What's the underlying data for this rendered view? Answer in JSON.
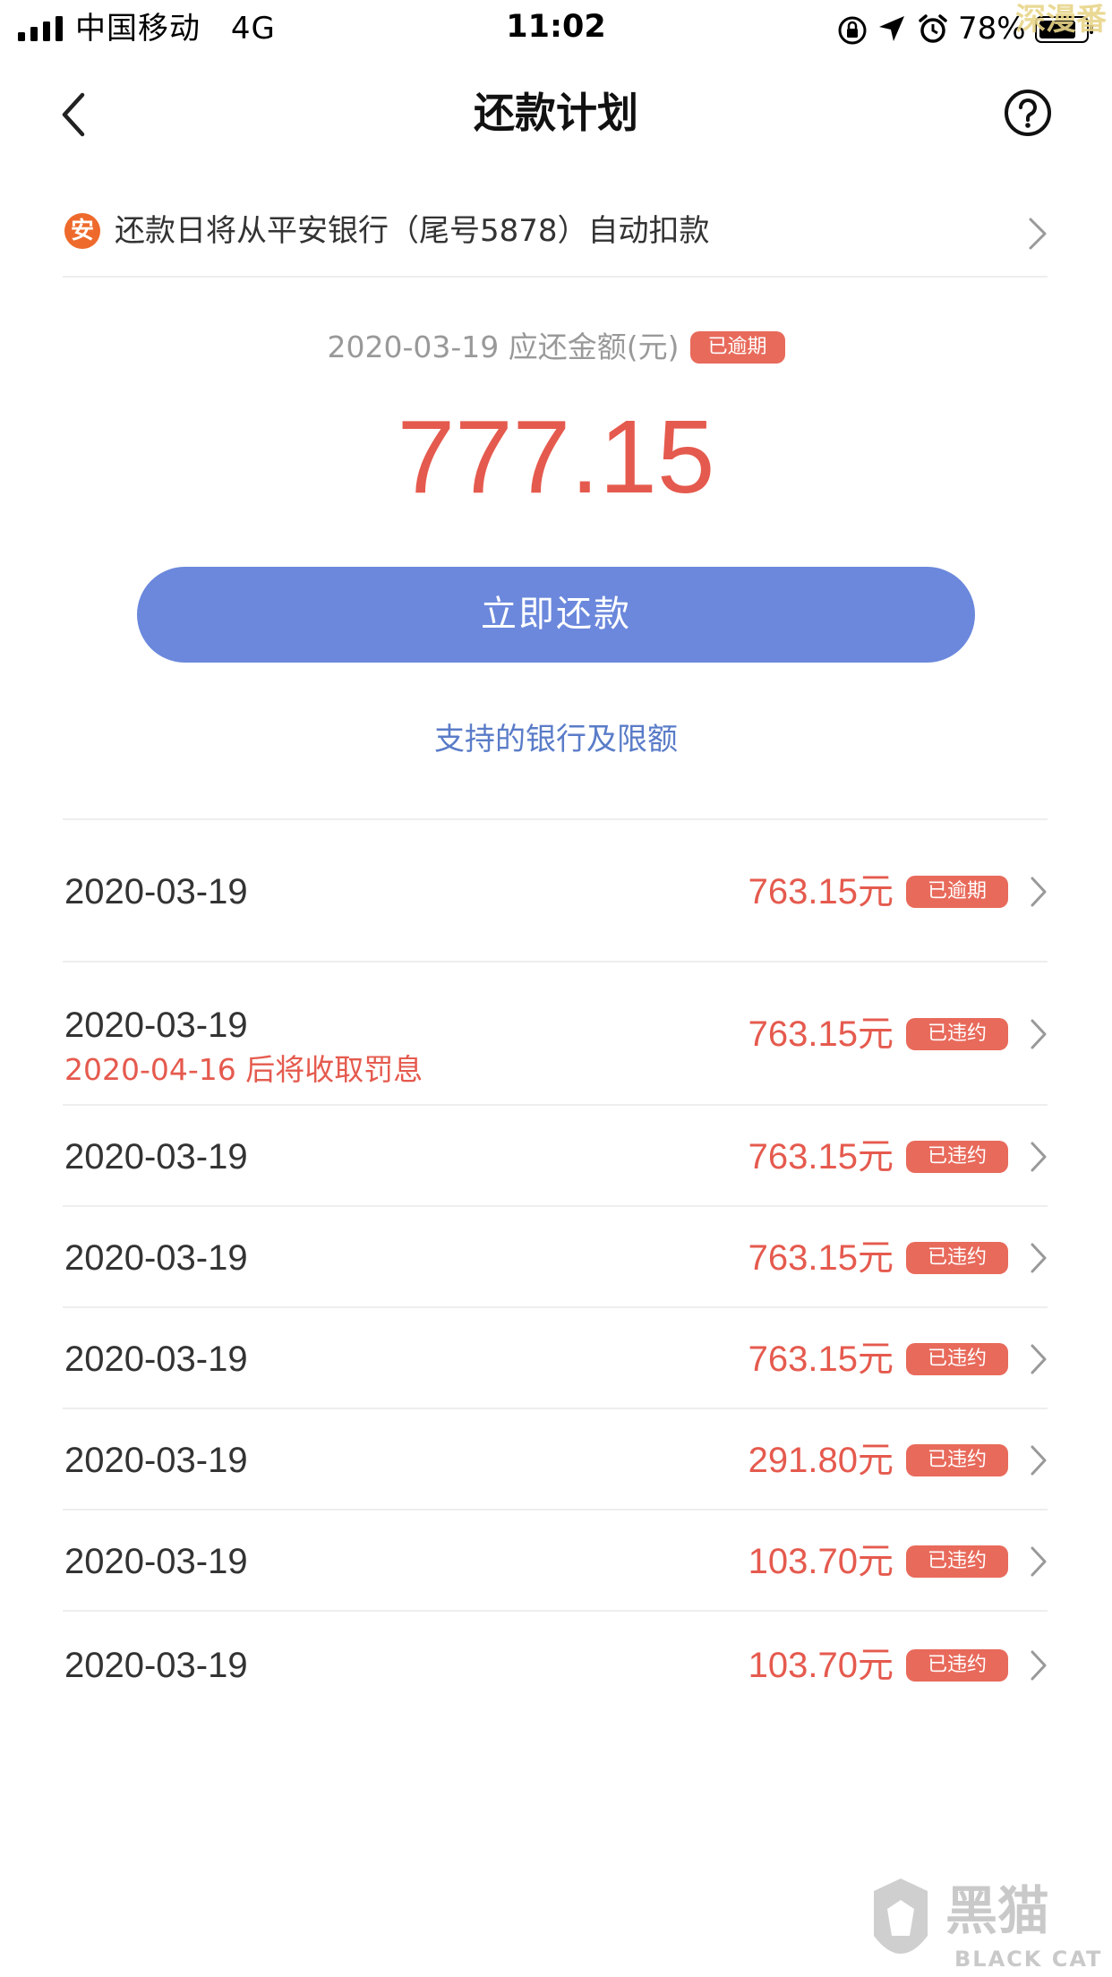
{
  "status_bar": {
    "carrier": "中国移动",
    "network": "4G",
    "time": "11:02",
    "battery_percent": "78%",
    "watermark": "深漫番"
  },
  "nav": {
    "title": "还款计划",
    "back_icon": "chevron-left-icon",
    "help_icon": "question-circle-icon"
  },
  "auto_debit": {
    "bank_icon_text": "安",
    "text": "还款日将从平安银行（尾号5878）自动扣款"
  },
  "summary": {
    "due_label": "2020-03-19 应还金额(元)",
    "status_badge": "已逾期",
    "amount": "777.15",
    "repay_button": "立即还款",
    "banks_link": "支持的银行及限额"
  },
  "plan_items": [
    {
      "date": "2020-03-19",
      "note": "",
      "amount": "763.15元",
      "status": "已逾期"
    },
    {
      "date": "2020-03-19",
      "note": "2020-04-16 后将收取罚息",
      "amount": "763.15元",
      "status": "已违约"
    },
    {
      "date": "2020-03-19",
      "note": "",
      "amount": "763.15元",
      "status": "已违约"
    },
    {
      "date": "2020-03-19",
      "note": "",
      "amount": "763.15元",
      "status": "已违约"
    },
    {
      "date": "2020-03-19",
      "note": "",
      "amount": "763.15元",
      "status": "已违约"
    },
    {
      "date": "2020-03-19",
      "note": "",
      "amount": "291.80元",
      "status": "已违约"
    },
    {
      "date": "2020-03-19",
      "note": "",
      "amount": "103.70元",
      "status": "已违约"
    },
    {
      "date": "2020-03-19",
      "note": "",
      "amount": "103.70元",
      "status": "已违约"
    }
  ],
  "watermark_bottom": {
    "cn": "黑猫",
    "en": "BLACK CAT"
  },
  "colors": {
    "accent_red": "#e55a4e",
    "badge_red": "#e86a5b",
    "button_blue": "#6b88dc",
    "link_blue": "#5a7cc8",
    "bank_orange": "#ee6a2c"
  }
}
